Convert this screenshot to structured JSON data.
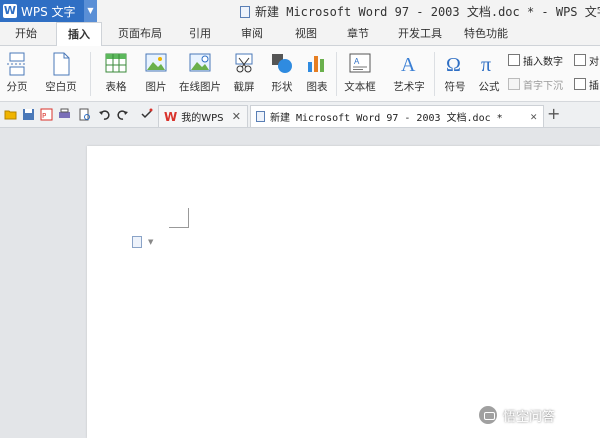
{
  "app": {
    "name": "WPS 文字",
    "logo": "W"
  },
  "window_title": "新建 Microsoft Word 97 - 2003 文档.doc * - WPS 文字",
  "tabs": [
    "开始",
    "插入",
    "页面布局",
    "引用",
    "审阅",
    "视图",
    "章节",
    "开发工具",
    "特色功能"
  ],
  "ribbon": {
    "page_break": "分页",
    "blank_page": "空白页",
    "table": "表格",
    "picture": "图片",
    "online_picture": "在线图片",
    "screenshot": "截屏",
    "shape": "形状",
    "chart": "图表",
    "textbox": "文本框",
    "wordart": "艺术字",
    "symbol": "符号",
    "formula": "公式",
    "insert_number": "插入数字",
    "dropcap": "首字下沉",
    "object_short": "对",
    "insert_short": "插"
  },
  "doc_tabs": [
    {
      "label": "我的WPS"
    },
    {
      "label": "新建 Microsoft Word 97 - 2003 文档.doc *"
    }
  ],
  "watermark": "悟空问答",
  "colors": {
    "accent": "#2f6fc4",
    "wps_red": "#d9322b"
  }
}
